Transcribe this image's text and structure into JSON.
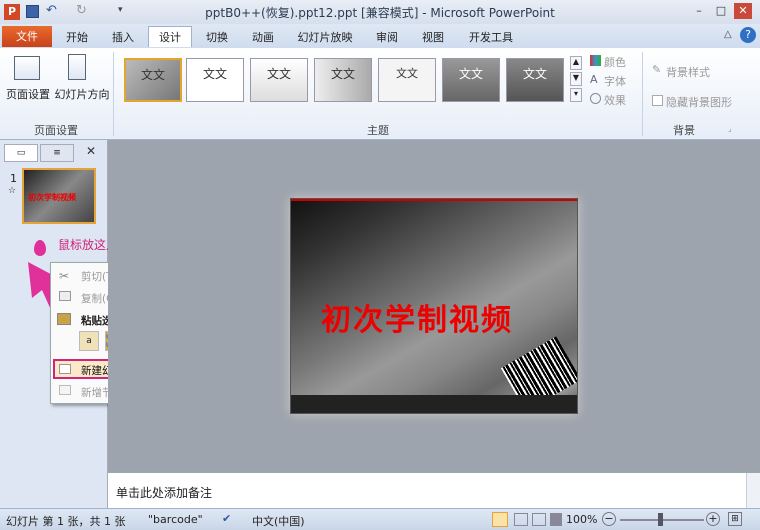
{
  "window": {
    "title": "pptB0++(恢复).ppt12.ppt [兼容模式] - Microsoft PowerPoint",
    "min": "–",
    "max": "□",
    "close": "✕"
  },
  "tabs": [
    "文件",
    "开始",
    "插入",
    "设计",
    "切换",
    "动画",
    "幻灯片放映",
    "审阅",
    "视图",
    "开发工具"
  ],
  "ribbon": {
    "page_setup": {
      "btn1": "页面设置",
      "btn2": "幻灯片方向",
      "group": "页面设置"
    },
    "themes": {
      "group": "主题",
      "thumb_text": "文文"
    },
    "theme_opts": {
      "colors": "颜色",
      "fonts": "字体",
      "effects": "效果"
    },
    "background": {
      "styles": "背景样式",
      "hide": "隐藏背景图形",
      "group": "背景"
    }
  },
  "panel": {
    "slide_number": "1",
    "star": "☆"
  },
  "annotation": "鼠标放这儿点击右键",
  "context_menu": {
    "cut": "剪切(T)",
    "copy": "复制(C)",
    "paste_options": "粘贴选项:",
    "new_slide": "新建幻灯片(N)",
    "new_section": "新增节(A)"
  },
  "slide": {
    "title": "初次学制视频"
  },
  "notes": {
    "placeholder": "单击此处添加备注"
  },
  "status": {
    "slide": "幻灯片 第 1 张，共 1 张",
    "theme": "\"barcode\"",
    "lang": "中文(中国)",
    "zoom": "100%"
  },
  "colors": {
    "accent": "#cc3a1a",
    "highlight": "#d0237a",
    "annot": "#e0309a"
  }
}
